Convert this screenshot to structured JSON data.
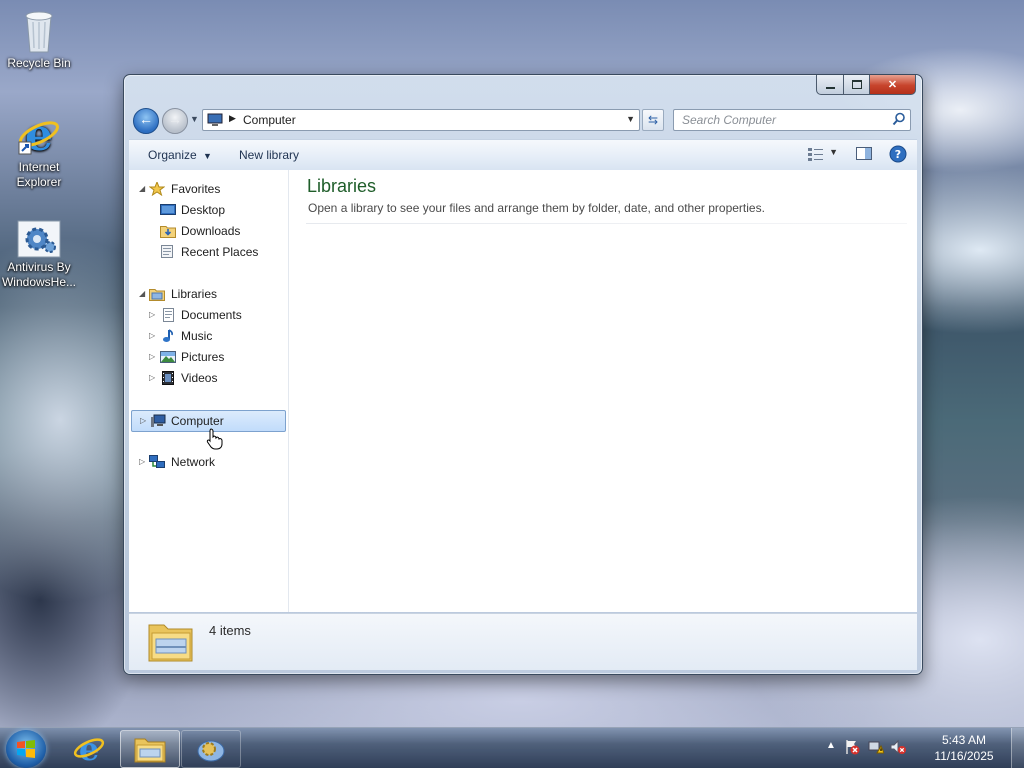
{
  "desktop": {
    "icons": [
      {
        "label": "Recycle Bin",
        "icon": "recycle-bin-icon"
      },
      {
        "label": "Internet Explorer",
        "icon": "internet-explorer-icon"
      },
      {
        "label": "Antivirus By WindowsHe...",
        "icon": "antivirus-gear-icon"
      }
    ]
  },
  "window": {
    "address_path": "Computer",
    "search_placeholder": "Search Computer",
    "toolbar": {
      "organize": "Organize",
      "new_library": "New library"
    },
    "nav": {
      "favorites": {
        "label": "Favorites",
        "items": [
          "Desktop",
          "Downloads",
          "Recent Places"
        ]
      },
      "libraries": {
        "label": "Libraries",
        "items": [
          "Documents",
          "Music",
          "Pictures",
          "Videos"
        ]
      },
      "computer": "Computer",
      "network": "Network"
    },
    "content": {
      "title": "Libraries",
      "subtitle": "Open a library to see your files and arrange them by folder, date, and other properties."
    },
    "details": {
      "count": "4 items"
    }
  },
  "taskbar": {
    "time": "5:43 AM",
    "date": "11/16/2025"
  },
  "colors": {
    "library_title": "#1e5d29",
    "selection": "#c1dcfb",
    "close_button": "#c7442c"
  }
}
